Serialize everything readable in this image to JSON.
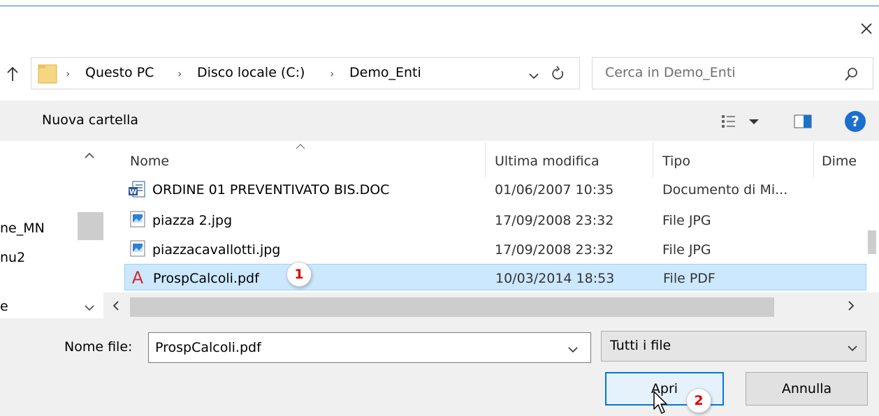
{
  "window": {
    "accent": "#2b79d0"
  },
  "address": {
    "crumbs": [
      "Questo PC",
      "Disco locale (C:)",
      "Demo_Enti"
    ]
  },
  "search": {
    "placeholder": "Cerca in Demo_Enti"
  },
  "toolbar": {
    "new_folder": "Nuova cartella"
  },
  "nav": {
    "items": [
      "ne_MN",
      "nu2",
      "e"
    ]
  },
  "columns": {
    "name": "Nome",
    "modified": "Ultima modifica",
    "type": "Tipo",
    "size": "Dime"
  },
  "files": [
    {
      "name": "ORDINE 01 PREVENTIVATO BIS.DOC",
      "modified": "01/06/2007 10:35",
      "type": "Documento di Mi...",
      "icon": "word-doc-icon"
    },
    {
      "name": "piazza 2.jpg",
      "modified": "17/09/2008 23:32",
      "type": "File JPG",
      "icon": "image-icon"
    },
    {
      "name": "piazzacavallotti.jpg",
      "modified": "17/09/2008 23:32",
      "type": "File JPG",
      "icon": "image-icon"
    },
    {
      "name": "ProspCalcoli.pdf",
      "modified": "10/03/2014 18:53",
      "type": "File PDF",
      "icon": "pdf-icon",
      "selected": true
    }
  ],
  "filename": {
    "label": "Nome file:",
    "value": "ProspCalcoli.pdf"
  },
  "filter": {
    "value": "Tutti i file"
  },
  "buttons": {
    "open": "Apri",
    "cancel": "Annulla"
  },
  "badges": {
    "one": "1",
    "two": "2"
  }
}
